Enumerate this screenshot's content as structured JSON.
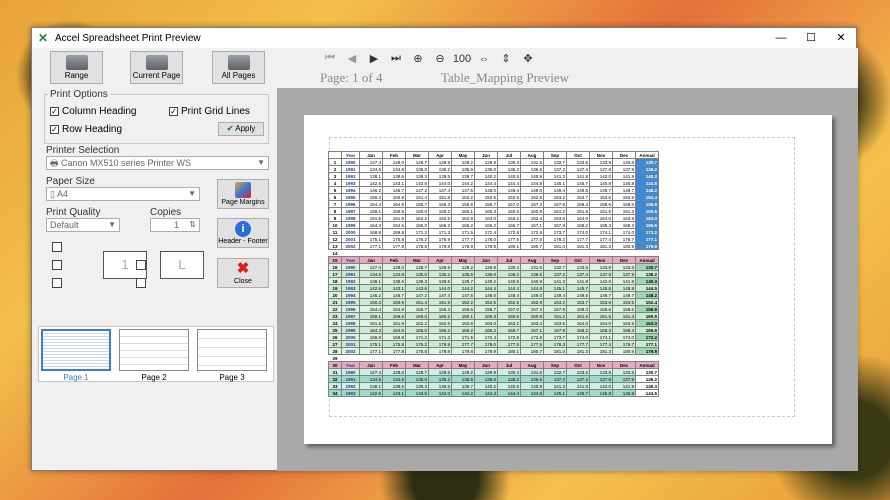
{
  "window": {
    "title": "Accel Spreadsheet Print Preview"
  },
  "toolbar": {
    "buttons": [
      "Range",
      "Current Page",
      "All Pages"
    ],
    "nav_icons": [
      "first-page-icon",
      "prev-page-icon",
      "next-page-icon",
      "last-page-icon",
      "zoom-in-icon",
      "zoom-out-icon",
      "zoom-100-icon",
      "fit-width-icon",
      "fit-height-icon",
      "fit-page-icon"
    ],
    "zoom_100_label": "100",
    "page_info": "Page: 1 of 4",
    "doc_name": "Table_Mapping Preview"
  },
  "print_options": {
    "title": "Print Options",
    "column_heading": "Column Heading",
    "print_grid_lines": "Print Grid Lines",
    "row_heading": "Row Heading",
    "apply": "Apply"
  },
  "printer": {
    "label": "Printer Selection",
    "value": "Canon MX510 series Printer WS"
  },
  "paper": {
    "label": "Paper Size",
    "value": "A4"
  },
  "quality": {
    "label": "Print Quality",
    "value": "Default"
  },
  "copies": {
    "label": "Copies",
    "value": "1"
  },
  "side_buttons": {
    "margins": "Page Margins",
    "header_footer": "Header - Footer",
    "close": "Close"
  },
  "orientation": {
    "portrait": "1",
    "landscape": "L"
  },
  "thumbnails": [
    "Page 1",
    "Page 2",
    "Page 3"
  ],
  "sheet": {
    "headers": [
      "Year",
      "Jan",
      "Feb",
      "Mar",
      "Apr",
      "May",
      "Jun",
      "Jul",
      "Aug",
      "Sep",
      "Oct",
      "Nov",
      "Dec",
      "Annual"
    ],
    "block1": [
      [
        "1",
        "1990",
        "127.4",
        "128.0",
        "128.7",
        "128.9",
        "129.2",
        "129.9",
        "130.4",
        "131.6",
        "132.7",
        "133.5",
        "133.8",
        "133.8",
        "130.7"
      ],
      [
        "2",
        "1991",
        "134.6",
        "134.8",
        "135.0",
        "135.2",
        "135.6",
        "136.0",
        "136.2",
        "136.6",
        "137.2",
        "137.4",
        "137.8",
        "137.9",
        "136.2"
      ],
      [
        "3",
        "1992",
        "138.1",
        "138.6",
        "139.3",
        "139.5",
        "139.7",
        "140.2",
        "140.5",
        "140.9",
        "141.3",
        "141.8",
        "142.0",
        "141.9",
        "140.3"
      ],
      [
        "4",
        "1993",
        "142.6",
        "143.1",
        "143.6",
        "144.0",
        "144.2",
        "144.4",
        "144.4",
        "144.8",
        "145.1",
        "145.7",
        "145.8",
        "145.8",
        "144.5"
      ],
      [
        "5",
        "1994",
        "146.2",
        "146.7",
        "147.2",
        "147.4",
        "147.5",
        "148.0",
        "148.4",
        "149.0",
        "149.4",
        "149.5",
        "149.7",
        "149.7",
        "148.2"
      ],
      [
        "6",
        "1995",
        "150.3",
        "150.9",
        "151.4",
        "151.9",
        "152.2",
        "152.5",
        "152.5",
        "152.9",
        "153.2",
        "153.7",
        "153.6",
        "153.5",
        "152.4"
      ],
      [
        "7",
        "1996",
        "154.4",
        "154.9",
        "155.7",
        "156.3",
        "156.6",
        "156.7",
        "157.0",
        "157.3",
        "157.8",
        "158.3",
        "158.6",
        "158.6",
        "156.9"
      ],
      [
        "8",
        "1997",
        "159.1",
        "159.6",
        "160.0",
        "160.2",
        "160.1",
        "160.3",
        "160.5",
        "160.8",
        "161.2",
        "161.6",
        "161.5",
        "161.3",
        "160.5"
      ],
      [
        "9",
        "1998",
        "161.6",
        "161.9",
        "162.2",
        "162.5",
        "162.8",
        "163.0",
        "163.2",
        "163.4",
        "163.6",
        "164.0",
        "164.0",
        "163.9",
        "163.0"
      ],
      [
        "10",
        "1999",
        "164.3",
        "164.5",
        "165.0",
        "166.2",
        "166.2",
        "166.2",
        "166.7",
        "167.1",
        "167.9",
        "168.2",
        "168.3",
        "168.3",
        "166.6"
      ],
      [
        "11",
        "2000",
        "168.8",
        "169.8",
        "171.2",
        "171.3",
        "171.5",
        "172.4",
        "172.8",
        "172.8",
        "173.7",
        "174.0",
        "174.1",
        "174.0",
        "172.2"
      ],
      [
        "12",
        "2001",
        "175.1",
        "175.8",
        "176.2",
        "176.9",
        "177.7",
        "178.0",
        "177.5",
        "177.5",
        "178.3",
        "177.7",
        "177.4",
        "176.7",
        "177.1"
      ],
      [
        "13",
        "2002",
        "177.1",
        "177.8",
        "178.8",
        "179.8",
        "179.8",
        "179.9",
        "180.1",
        "180.7",
        "181.0",
        "181.3",
        "181.3",
        "180.9",
        "179.9"
      ]
    ],
    "block2": [
      [
        "16",
        "1990",
        "127.4",
        "128.0",
        "128.7",
        "128.9",
        "129.2",
        "129.9",
        "130.4",
        "131.6",
        "132.7",
        "133.5",
        "133.8",
        "133.8",
        "130.7"
      ],
      [
        "17",
        "1991",
        "134.6",
        "134.8",
        "135.0",
        "135.2",
        "135.6",
        "136.0",
        "136.2",
        "136.6",
        "137.2",
        "137.4",
        "137.8",
        "137.9",
        "136.2"
      ],
      [
        "18",
        "1992",
        "138.1",
        "138.6",
        "139.3",
        "139.5",
        "139.7",
        "140.2",
        "140.5",
        "140.9",
        "141.3",
        "141.8",
        "142.0",
        "141.9",
        "140.3"
      ],
      [
        "19",
        "1993",
        "142.6",
        "143.1",
        "143.6",
        "144.0",
        "144.2",
        "144.4",
        "144.4",
        "144.8",
        "145.1",
        "145.7",
        "145.8",
        "145.8",
        "144.5"
      ],
      [
        "20",
        "1994",
        "146.2",
        "146.7",
        "147.2",
        "147.4",
        "147.5",
        "148.0",
        "148.4",
        "149.0",
        "149.4",
        "149.5",
        "149.7",
        "149.7",
        "148.2"
      ],
      [
        "21",
        "1995",
        "150.3",
        "150.9",
        "151.4",
        "151.9",
        "152.2",
        "152.5",
        "152.5",
        "152.9",
        "153.2",
        "153.7",
        "153.6",
        "153.5",
        "152.4"
      ],
      [
        "22",
        "1996",
        "154.4",
        "154.9",
        "155.7",
        "156.3",
        "156.6",
        "156.7",
        "157.0",
        "157.3",
        "157.8",
        "158.3",
        "158.6",
        "158.6",
        "156.9"
      ],
      [
        "23",
        "1997",
        "159.1",
        "159.6",
        "160.0",
        "160.2",
        "160.1",
        "160.3",
        "160.5",
        "160.8",
        "161.2",
        "161.6",
        "161.5",
        "161.3",
        "160.5"
      ],
      [
        "24",
        "1998",
        "161.6",
        "161.9",
        "162.2",
        "162.5",
        "162.8",
        "163.0",
        "163.2",
        "163.4",
        "163.6",
        "164.0",
        "164.0",
        "163.9",
        "163.0"
      ],
      [
        "25",
        "1999",
        "164.3",
        "164.5",
        "165.0",
        "166.2",
        "166.2",
        "166.2",
        "166.7",
        "167.1",
        "167.9",
        "168.2",
        "168.3",
        "168.3",
        "166.6"
      ],
      [
        "26",
        "2000",
        "168.8",
        "169.8",
        "171.2",
        "171.3",
        "171.5",
        "172.4",
        "172.8",
        "172.8",
        "173.7",
        "174.0",
        "174.1",
        "174.0",
        "172.2"
      ],
      [
        "27",
        "2001",
        "175.1",
        "175.8",
        "176.2",
        "176.9",
        "177.7",
        "178.0",
        "177.5",
        "177.5",
        "178.3",
        "177.7",
        "177.4",
        "176.7",
        "177.1"
      ],
      [
        "28",
        "2002",
        "177.1",
        "177.8",
        "178.8",
        "179.8",
        "179.8",
        "179.9",
        "180.1",
        "180.7",
        "181.0",
        "181.3",
        "181.3",
        "180.9",
        "179.9"
      ]
    ],
    "block3": [
      [
        "31",
        "1990",
        "127.4",
        "128.0",
        "128.7",
        "128.9",
        "129.2",
        "129.9",
        "130.4",
        "131.6",
        "132.7",
        "133.5",
        "133.8",
        "133.8",
        "130.7"
      ],
      [
        "32",
        "1991",
        "134.6",
        "134.8",
        "135.0",
        "135.2",
        "135.6",
        "136.0",
        "136.2",
        "136.6",
        "137.2",
        "137.4",
        "137.8",
        "137.9",
        "136.2"
      ],
      [
        "33",
        "1992",
        "138.1",
        "138.6",
        "139.3",
        "139.5",
        "139.7",
        "140.2",
        "140.5",
        "140.9",
        "141.3",
        "141.8",
        "142.0",
        "141.9",
        "140.3"
      ],
      [
        "34",
        "1993",
        "142.6",
        "143.1",
        "143.6",
        "144.0",
        "144.2",
        "144.4",
        "144.4",
        "144.8",
        "145.1",
        "145.7",
        "145.8",
        "145.8",
        "144.5"
      ]
    ],
    "header_rows": {
      "h1": "",
      "h2": "15",
      "h3": "30"
    },
    "gap_rows": [
      "14",
      "29"
    ]
  }
}
